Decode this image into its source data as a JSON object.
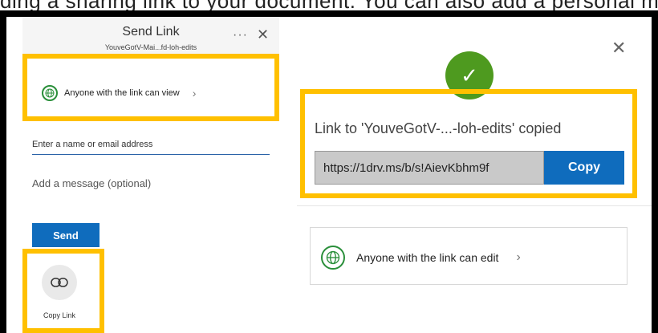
{
  "caption": {
    "text": "ding a sharing link to your document. You can also add a personal message and send the link to specific people"
  },
  "send_panel": {
    "title": "Send Link",
    "subtitle": "YouveGotV-Mai...fd-loh-edits",
    "more_label": "···",
    "close_label": "✕",
    "permission": {
      "label": "Anyone with the link can view",
      "chevron": "›"
    },
    "name_field": {
      "placeholder": "Enter a name or email address",
      "value": ""
    },
    "message_field": {
      "placeholder": "Add a message (optional)",
      "value": ""
    },
    "send_label": "Send",
    "copy_link_label": "Copy Link"
  },
  "copied_dialog": {
    "close_label": "✕",
    "check_label": "✓",
    "message": "Link to 'YouveGotV-...-loh-edits' copied",
    "url_value": "https://1drv.ms/b/s!AievKbhm9f",
    "copy_label": "Copy",
    "edit_permission": {
      "label": "Anyone with the link can edit",
      "chevron": "›"
    }
  },
  "colors": {
    "highlight": "#ffc000",
    "accent_blue": "#0f6cbd",
    "success_green": "#4e9a1f",
    "globe_green": "#2a8f3a"
  },
  "icons": {
    "globe": "globe-icon",
    "link": "link-icon",
    "check": "check-icon",
    "close": "close-icon",
    "more": "more-icon",
    "chevron": "chevron-right-icon"
  }
}
